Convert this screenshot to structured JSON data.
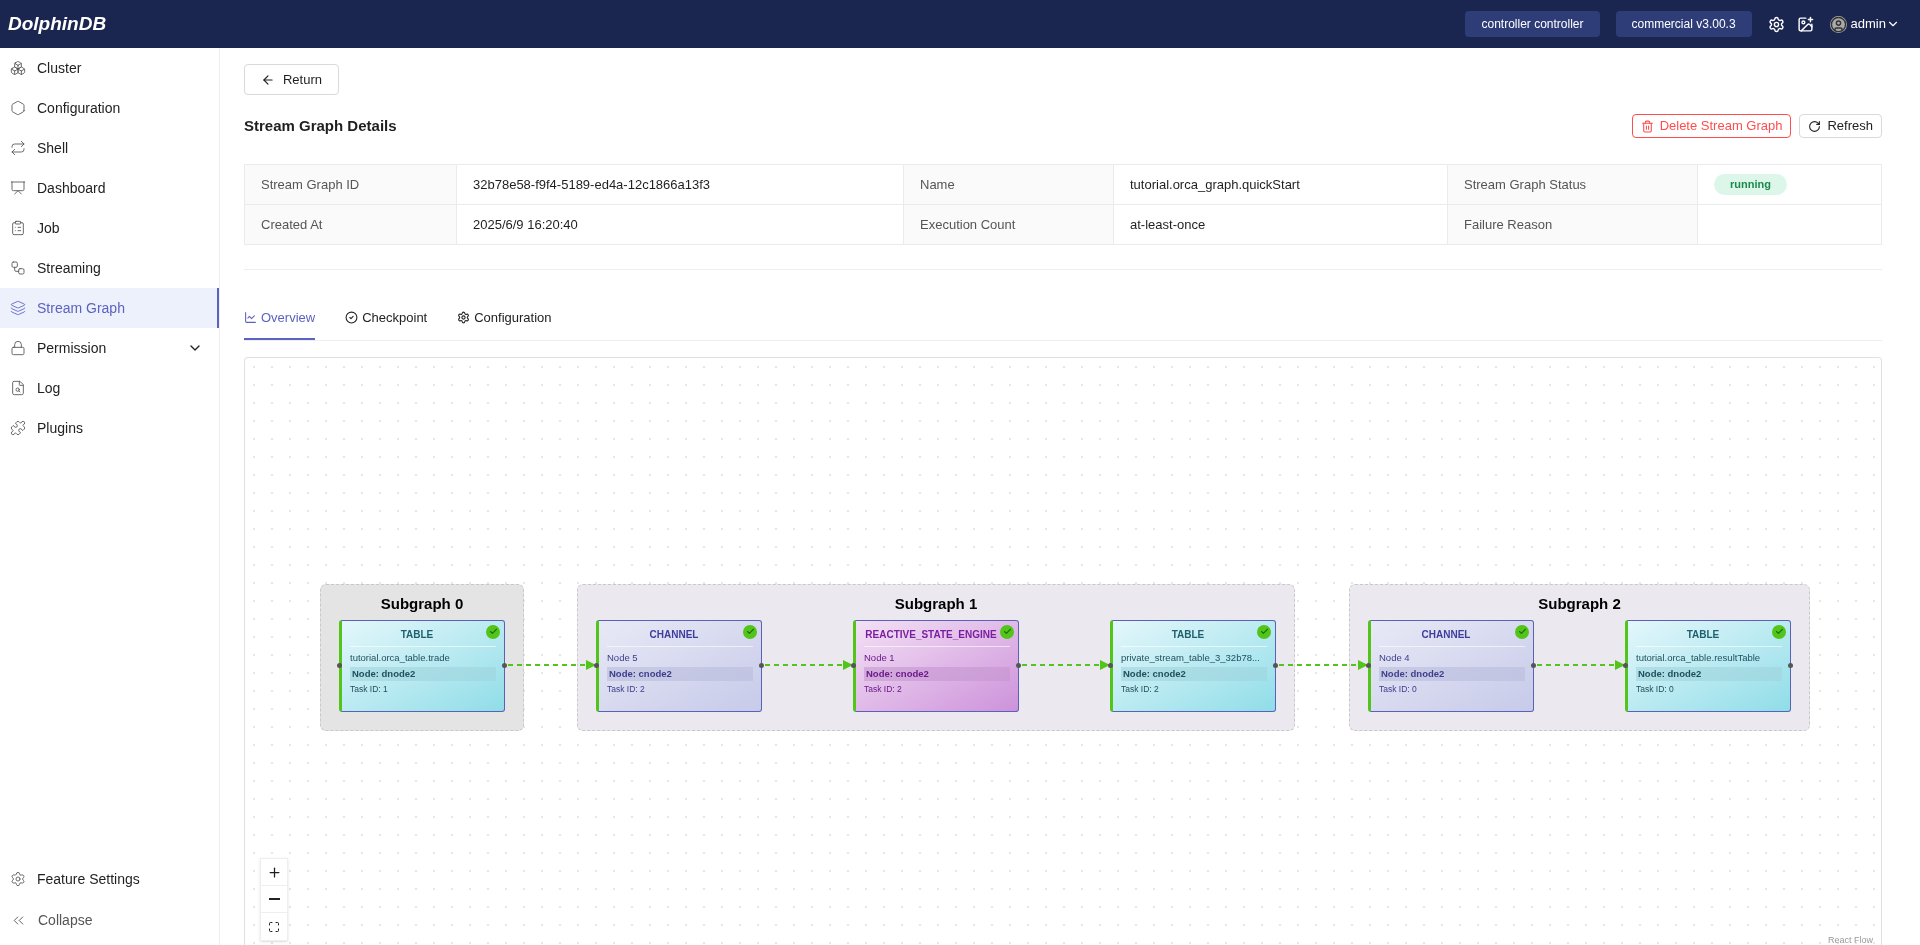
{
  "topbar": {
    "logo": "DolphinDB",
    "badges": [
      "controller controller",
      "commercial v3.00.3"
    ],
    "user": "admin"
  },
  "sidebar": {
    "items": [
      {
        "label": "Cluster",
        "selected": false
      },
      {
        "label": "Configuration",
        "selected": false
      },
      {
        "label": "Shell",
        "selected": false
      },
      {
        "label": "Dashboard",
        "selected": false
      },
      {
        "label": "Job",
        "selected": false
      },
      {
        "label": "Streaming",
        "selected": false
      },
      {
        "label": "Stream Graph",
        "selected": true
      },
      {
        "label": "Permission",
        "selected": false,
        "expanded": false
      },
      {
        "label": "Log",
        "selected": false
      },
      {
        "label": "Plugins",
        "selected": false
      }
    ],
    "footer": [
      "Feature Settings",
      "Collapse"
    ]
  },
  "return_button": "Return",
  "page_title": "Stream Graph Details",
  "actions": [
    {
      "label": "Delete Stream Graph",
      "kind": "danger"
    },
    {
      "label": "Refresh",
      "kind": "default"
    }
  ],
  "details": {
    "rows": [
      [
        {
          "label": "Stream Graph ID",
          "value": "32b78e58-f9f4-5189-ed4a-12c1866a13f3"
        },
        {
          "label": "Name",
          "value": "tutorial.orca_graph.quickStart"
        },
        {
          "label": "Stream Graph Status",
          "value": "running",
          "kind": "badge"
        }
      ],
      [
        {
          "label": "Created At",
          "value": "2025/6/9 16:20:40"
        },
        {
          "label": "Execution Count",
          "value": "at-least-once"
        },
        {
          "label": "Failure Reason"
        }
      ]
    ]
  },
  "tabs": [
    {
      "label": "Overview",
      "selected": true
    },
    {
      "label": "Checkpoint",
      "selected": false
    },
    {
      "label": "Configuration",
      "selected": false
    }
  ],
  "graph": {
    "subgraphs": [
      {
        "title": "Subgraph 0",
        "nodes": [
          {
            "kind": "table",
            "title": "TABLE",
            "name": "tutorial.orca_table.trade",
            "node": "Node: dnode2",
            "task": "Task ID: 1",
            "ok": true
          }
        ]
      },
      {
        "title": "Subgraph 1",
        "nodes": [
          {
            "kind": "channel",
            "title": "CHANNEL",
            "name": "Node 5",
            "node": "Node: cnode2",
            "task": "Task ID: 2",
            "ok": true
          },
          {
            "kind": "engine",
            "title": "REACTIVE_STATE_ENGINE",
            "name": "Node 1",
            "node": "Node: cnode2",
            "task": "Task ID: 2",
            "ok": true
          },
          {
            "kind": "table",
            "title": "TABLE",
            "name": "private_stream_table_3_32b78...",
            "node": "Node: cnode2",
            "task": "Task ID: 2",
            "ok": true
          }
        ]
      },
      {
        "title": "Subgraph 2",
        "nodes": [
          {
            "kind": "channel",
            "title": "CHANNEL",
            "name": "Node 4",
            "node": "Node: dnode2",
            "task": "Task ID: 0",
            "ok": true
          },
          {
            "kind": "table",
            "title": "TABLE",
            "name": "tutorial.orca_table.resultTable",
            "node": "Node: dnode2",
            "task": "Task ID: 0",
            "ok": true
          }
        ]
      }
    ],
    "attribution": "React Flow"
  }
}
